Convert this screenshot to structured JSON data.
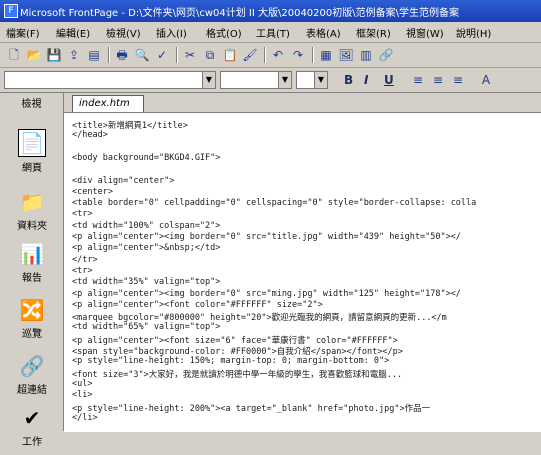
{
  "window": {
    "title": "Microsoft FrontPage - D:\\文件夹\\网页\\cw04计划 II 大版\\20040200初版\\范例备案\\学生范例备案"
  },
  "menu": [
    "檔案(F)",
    "編輯(E)",
    "檢視(V)",
    "插入(I)",
    "格式(O)",
    "工具(T)",
    "表格(A)",
    "框架(R)",
    "視窗(W)",
    "說明(H)"
  ],
  "toolbar1": {
    "icons": [
      "new-icon",
      "open-icon",
      "save-icon",
      "publish-icon",
      "folder-icon",
      "print-icon",
      "preview-icon",
      "spell-icon",
      "cut-icon",
      "copy-icon",
      "paste-icon",
      "format-painter-icon",
      "undo-icon",
      "redo-icon",
      "table-icon",
      "image-icon",
      "chart-icon",
      "hyperlink-icon"
    ]
  },
  "toolbar2": {
    "style_value": "",
    "font_value": "",
    "size_value": "",
    "bold": "B",
    "italic": "I",
    "underline": "U"
  },
  "views": {
    "title": "檢視",
    "items": [
      {
        "label": "網頁",
        "icon": "page-icon",
        "glyph": "📄"
      },
      {
        "label": "資料夾",
        "icon": "folder-icon",
        "glyph": "📁"
      },
      {
        "label": "報告",
        "icon": "reports-icon",
        "glyph": "📊"
      },
      {
        "label": "巡覽",
        "icon": "navigation-icon",
        "glyph": "🔀"
      },
      {
        "label": "超連結",
        "icon": "hyperlinks-icon",
        "glyph": "🔗"
      },
      {
        "label": "工作",
        "icon": "tasks-icon",
        "glyph": "✔"
      }
    ]
  },
  "tab": {
    "label": "index.htm"
  },
  "code": [
    "<title>新增網頁1</title>",
    "</head>",
    "",
    "<body background=\"BKGD4.GIF\">",
    "",
    "<div align=\"center\">",
    "  <center>",
    "  <table border=\"0\" cellpadding=\"0\" cellspacing=\"0\" style=\"border-collapse: colla",
    "    <tr>",
    "      <td width=\"100%\" colspan=\"2\">",
    "      <p align=\"center\"><img border=\"0\" src=\"title.jpg\" width=\"439\" height=\"50\"></",
    "      <p align=\"center\">&nbsp;</td>",
    "    </tr>",
    "    <tr>",
    "      <td width=\"35%\" valign=\"top\">",
    "      <p align=\"center\"><img border=\"0\" src=\"ming.jpg\" width=\"125\" height=\"178\"></",
    "      <p align=\"center\"><font color=\"#FFFFFF\" size=\"2\">",
    "      <marquee bgcolor=\"#800000\" height=\"20\">歡迎光臨我的網頁，請留意網頁的更新...</m",
    "      <td width=\"65%\" valign=\"top\">",
    "      <p align=\"center\"><font size=\"6\" face=\"華康行書\" color=\"#FFFFFF\">",
    "      <span style=\"background-color: #FF0000\">自我介紹</span></font></p>",
    "      <p style=\"line-height: 150%; margin-top: 0; margin-bottom: 0\">",
    "      <font size=\"3\">大家好，我是就讀於明德中學一年級的學生，我喜歡籃球和電腦...",
    "      <ul>",
    "        <li>",
    "        <p style=\"line-height: 200%\"><a target=\"_blank\" href=\"photo.jpg\">作品一",
    "        </li>"
  ]
}
